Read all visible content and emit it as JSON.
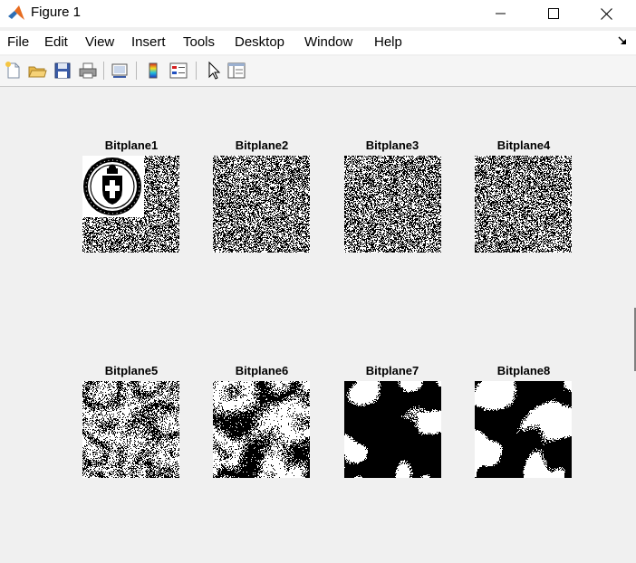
{
  "window": {
    "title": "Figure 1"
  },
  "menubar": {
    "items": [
      "File",
      "Edit",
      "View",
      "Insert",
      "Tools",
      "Desktop",
      "Window",
      "Help"
    ]
  },
  "toolbar": {
    "buttons": [
      "new-figure-icon",
      "open-file-icon",
      "save-icon",
      "print-icon",
      "link-plot-icon",
      "insert-colorbar-icon",
      "insert-legend-icon",
      "edit-plot-icon",
      "property-inspector-icon"
    ]
  },
  "figure": {
    "subplots": [
      {
        "title": "Bitplane1",
        "pattern": "watermark-noise"
      },
      {
        "title": "Bitplane2",
        "pattern": "noise"
      },
      {
        "title": "Bitplane3",
        "pattern": "noise"
      },
      {
        "title": "Bitplane4",
        "pattern": "noise"
      },
      {
        "title": "Bitplane5",
        "pattern": "structure-light"
      },
      {
        "title": "Bitplane6",
        "pattern": "structure-medium"
      },
      {
        "title": "Bitplane7",
        "pattern": "structure-strong"
      },
      {
        "title": "Bitplane8",
        "pattern": "structure-msb"
      }
    ]
  }
}
